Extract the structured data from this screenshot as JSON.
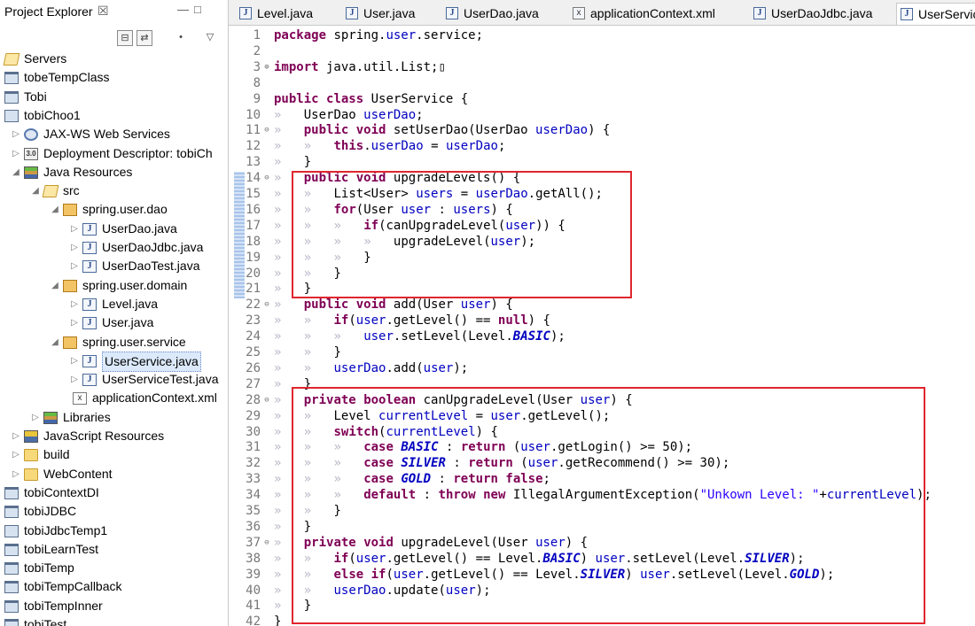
{
  "explorer": {
    "title": "Project Explorer",
    "close_glyph": "☒",
    "minmax_glyphs": "—□",
    "toolbar": [
      {
        "icon": "collapse-all-icon",
        "glyph": "⊟"
      },
      {
        "icon": "link-with-editor-icon",
        "glyph": "⇄"
      },
      {
        "icon": "focus-icon",
        "glyph": "•"
      },
      {
        "icon": "view-menu-icon",
        "glyph": "▽"
      }
    ],
    "tree": [
      {
        "label": "Servers",
        "depth": 0,
        "twisty": "",
        "icon": "folder-open"
      },
      {
        "label": "tobeTempClass",
        "depth": 0,
        "twisty": "",
        "icon": "project"
      },
      {
        "label": "Tobi",
        "depth": 0,
        "twisty": "",
        "icon": "project"
      },
      {
        "label": "tobiChoo1",
        "depth": 0,
        "twisty": "",
        "icon": "webproject"
      },
      {
        "label": "JAX-WS Web Services",
        "depth": 1,
        "twisty": "▷",
        "icon": "gear"
      },
      {
        "label": "Deployment Descriptor: tobiCh",
        "depth": 1,
        "twisty": "▷",
        "icon": "dd"
      },
      {
        "label": "Java Resources",
        "depth": 1,
        "twisty": "◢",
        "icon": "lib"
      },
      {
        "label": "src",
        "depth": 2,
        "twisty": "◢",
        "icon": "folder-open"
      },
      {
        "label": "spring.user.dao",
        "depth": 3,
        "twisty": "◢",
        "icon": "package"
      },
      {
        "label": "UserDao.java",
        "depth": 4,
        "twisty": "▷",
        "icon": "java"
      },
      {
        "label": "UserDaoJdbc.java",
        "depth": 4,
        "twisty": "▷",
        "icon": "java"
      },
      {
        "label": "UserDaoTest.java",
        "depth": 4,
        "twisty": "▷",
        "icon": "java"
      },
      {
        "label": "spring.user.domain",
        "depth": 3,
        "twisty": "◢",
        "icon": "package"
      },
      {
        "label": "Level.java",
        "depth": 4,
        "twisty": "▷",
        "icon": "java"
      },
      {
        "label": "User.java",
        "depth": 4,
        "twisty": "▷",
        "icon": "java"
      },
      {
        "label": "spring.user.service",
        "depth": 3,
        "twisty": "◢",
        "icon": "package"
      },
      {
        "label": "UserService.java",
        "depth": 4,
        "twisty": "▷",
        "icon": "java",
        "selected": true
      },
      {
        "label": "UserServiceTest.java",
        "depth": 4,
        "twisty": "▷",
        "icon": "java"
      },
      {
        "label": "applicationContext.xml",
        "depth": 3.5,
        "twisty": "",
        "icon": "xml"
      },
      {
        "label": "Libraries",
        "depth": 2,
        "twisty": "▷",
        "icon": "lib"
      },
      {
        "label": "JavaScript Resources",
        "depth": 1,
        "twisty": "▷",
        "icon": "jsres"
      },
      {
        "label": "build",
        "depth": 1,
        "twisty": "▷",
        "icon": "folder"
      },
      {
        "label": "WebContent",
        "depth": 1,
        "twisty": "▷",
        "icon": "folder"
      },
      {
        "label": "tobiContextDI",
        "depth": 0,
        "twisty": "",
        "icon": "project"
      },
      {
        "label": "tobiJDBC",
        "depth": 0,
        "twisty": "",
        "icon": "project"
      },
      {
        "label": "tobiJdbcTemp1",
        "depth": 0,
        "twisty": "",
        "icon": "webproject"
      },
      {
        "label": "tobiLearnTest",
        "depth": 0,
        "twisty": "",
        "icon": "project"
      },
      {
        "label": "tobiTemp",
        "depth": 0,
        "twisty": "",
        "icon": "project"
      },
      {
        "label": "tobiTempCallback",
        "depth": 0,
        "twisty": "",
        "icon": "project"
      },
      {
        "label": "tobiTempInner",
        "depth": 0,
        "twisty": "",
        "icon": "project"
      },
      {
        "label": "tobiTest",
        "depth": 0,
        "twisty": "",
        "icon": "project"
      }
    ]
  },
  "editor": {
    "tabs": [
      {
        "label": "Level.java",
        "icon": "java"
      },
      {
        "label": "User.java",
        "icon": "java"
      },
      {
        "label": "UserDao.java",
        "icon": "java"
      },
      {
        "label": "applicationContext.xml",
        "icon": "xml"
      },
      {
        "label": "UserDaoJdbc.java",
        "icon": "java"
      },
      {
        "label": "UserServic",
        "icon": "java",
        "active": true
      }
    ],
    "lines": [
      {
        "n": "1",
        "fold": "",
        "code": "package spring.user.service;"
      },
      {
        "n": "2",
        "fold": "",
        "code": ""
      },
      {
        "n": "3",
        "fold": "⊕",
        "code": "import java.util.List;▯"
      },
      {
        "n": "8",
        "fold": "",
        "code": ""
      },
      {
        "n": "9",
        "fold": "",
        "code": "public class UserService {"
      },
      {
        "n": "10",
        "fold": "",
        "code": "»   UserDao userDao;"
      },
      {
        "n": "11",
        "fold": "⊖",
        "code": "»   public void setUserDao(UserDao userDao) {"
      },
      {
        "n": "12",
        "fold": "",
        "code": "»   »   this.userDao = userDao;"
      },
      {
        "n": "13",
        "fold": "",
        "code": "»   }"
      },
      {
        "n": "14",
        "fold": "⊖",
        "code": "»   public void upgradeLevels() {"
      },
      {
        "n": "15",
        "fold": "",
        "code": "»   »   List<User> users = userDao.getAll();"
      },
      {
        "n": "16",
        "fold": "",
        "code": "»   »   for(User user : users) {"
      },
      {
        "n": "17",
        "fold": "",
        "code": "»   »   »   if(canUpgradeLevel(user)) {"
      },
      {
        "n": "18",
        "fold": "",
        "code": "»   »   »   »   upgradeLevel(user);"
      },
      {
        "n": "19",
        "fold": "",
        "code": "»   »   »   }"
      },
      {
        "n": "20",
        "fold": "",
        "code": "»   »   }"
      },
      {
        "n": "21",
        "fold": "",
        "code": "»   }"
      },
      {
        "n": "22",
        "fold": "⊖",
        "code": "»   public void add(User user) {"
      },
      {
        "n": "23",
        "fold": "",
        "code": "»   »   if(user.getLevel() == null) {"
      },
      {
        "n": "24",
        "fold": "",
        "code": "»   »   »   user.setLevel(Level.BASIC);"
      },
      {
        "n": "25",
        "fold": "",
        "code": "»   »   }"
      },
      {
        "n": "26",
        "fold": "",
        "code": "»   »   userDao.add(user);"
      },
      {
        "n": "27",
        "fold": "",
        "code": "»   }"
      },
      {
        "n": "28",
        "fold": "⊖",
        "code": "»   private boolean canUpgradeLevel(User user) {"
      },
      {
        "n": "29",
        "fold": "",
        "code": "»   »   Level currentLevel = user.getLevel();"
      },
      {
        "n": "30",
        "fold": "",
        "code": "»   »   switch(currentLevel) {"
      },
      {
        "n": "31",
        "fold": "",
        "code": "»   »   »   case BASIC : return (user.getLogin() >= 50);"
      },
      {
        "n": "32",
        "fold": "",
        "code": "»   »   »   case SILVER : return (user.getRecommend() >= 30);"
      },
      {
        "n": "33",
        "fold": "",
        "code": "»   »   »   case GOLD : return false;"
      },
      {
        "n": "34",
        "fold": "",
        "code": "»   »   »   default : throw new IllegalArgumentException(\"Unkown Level: \"+currentLevel);"
      },
      {
        "n": "35",
        "fold": "",
        "code": "»   »   }"
      },
      {
        "n": "36",
        "fold": "",
        "code": "»   }"
      },
      {
        "n": "37",
        "fold": "⊖",
        "code": "»   private void upgradeLevel(User user) {"
      },
      {
        "n": "38",
        "fold": "",
        "code": "»   »   if(user.getLevel() == Level.BASIC) user.setLevel(Level.SILVER);"
      },
      {
        "n": "39",
        "fold": "",
        "code": "»   »   else if(user.getLevel() == Level.SILVER) user.setLevel(Level.GOLD);"
      },
      {
        "n": "40",
        "fold": "",
        "code": "»   »   userDao.update(user);"
      },
      {
        "n": "41",
        "fold": "",
        "code": "»   }"
      },
      {
        "n": "42",
        "fold": "",
        "code": "}"
      }
    ],
    "keywords": [
      "package",
      "import",
      "public",
      "class",
      "void",
      "this",
      "for",
      "if",
      "else",
      "private",
      "boolean",
      "switch",
      "case",
      "return",
      "default",
      "throw",
      "new",
      "false",
      "null"
    ],
    "fields": [
      "userDao",
      "users",
      "user",
      "currentLevel"
    ],
    "constants": [
      "BASIC",
      "SILVER",
      "GOLD"
    ],
    "highlight_color": "#e0262f"
  }
}
